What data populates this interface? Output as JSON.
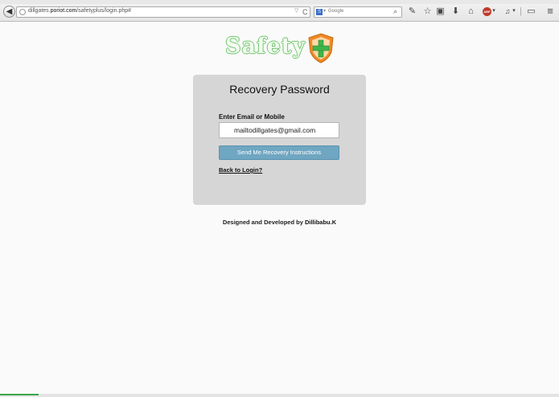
{
  "browser": {
    "url_host": "dillgates.",
    "url_domain": "poriot.com",
    "url_path": "/safetyplus/login.php#",
    "search_engine_letter": "S",
    "search_placeholder": "Google",
    "nav_glyphs": {
      "back": "◀",
      "reload": "C",
      "url_drop": "▽",
      "engine_drop": "▾",
      "search_go": "⌕"
    },
    "toolbar_glyphs": {
      "reader": "✎",
      "bookmark": "☆",
      "clipboard": "▣",
      "download": "⬇",
      "home": "⌂",
      "abp": "ABP",
      "abp_drop": "▾",
      "extension": "♫",
      "extension_drop": "▾",
      "separator": "|",
      "window": "▭",
      "menu": "≡"
    },
    "colors": {
      "abp": "#c0392b",
      "load_bar": "#3aa64a"
    }
  },
  "page": {
    "logo_text": "Safety",
    "card": {
      "title": "Recovery Password",
      "field_label": "Enter Email or Mobile",
      "email_value": "mailtodillgates@gmail.com",
      "submit_label": "Send Me Recovery Instructions",
      "back_link": "Back to Login?"
    },
    "footer": {
      "prefix": "Designed and Developed by",
      "author": "Dillibabu.K"
    },
    "colors": {
      "card_bg": "#d6d6d6",
      "button_bg": "#6fa6c1",
      "logo_outline": "#6ec46a",
      "shield_orange": "#f08a24",
      "shield_cross": "#3fb54a"
    }
  }
}
